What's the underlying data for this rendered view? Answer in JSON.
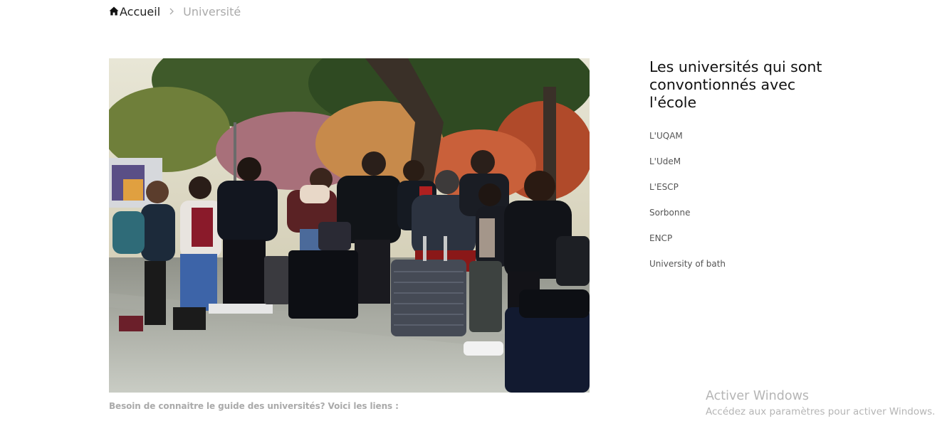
{
  "breadcrumb": {
    "home_label": "Accueil",
    "separator": ">",
    "current": "Université"
  },
  "photo": {
    "alt": "Groupe d'étudiants avec valises sous les arbres"
  },
  "caption": "Besoin de connaitre le guide des universités? Voici les liens :",
  "sidebar": {
    "title": "Les universités qui sont convontionnés avec l'école",
    "items": [
      {
        "label": "L'UQAM"
      },
      {
        "label": "L'UdeM"
      },
      {
        "label": "L'ESCP"
      },
      {
        "label": "Sorbonne"
      },
      {
        "label": "ENCP"
      },
      {
        "label": "University of bath"
      }
    ]
  },
  "watermark": {
    "title": "Activer Windows",
    "subtitle": "Accédez aux paramètres pour activer Windows."
  },
  "colors": {
    "text_dark": "#111111",
    "text_muted": "#aaaaaa",
    "list_text": "#555555",
    "watermark": "#b5b5b5"
  },
  "icons": {
    "home": "home-icon"
  }
}
